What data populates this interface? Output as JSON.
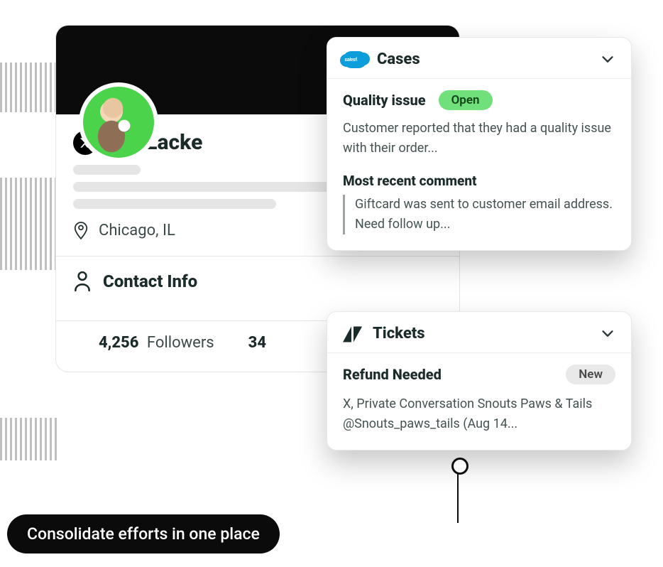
{
  "profile": {
    "name": "Joy Lacke",
    "location": "Chicago, IL",
    "contact_section": "Contact Info",
    "followers_count": "4,256",
    "followers_label": "Followers",
    "stat2_partial": "34"
  },
  "cases": {
    "header": "Cases",
    "salesforce_label": "salesforce",
    "item": {
      "title": "Quality issue",
      "status": "Open",
      "description": "Customer reported that they had a quality issue with their order...",
      "comment_label": "Most recent comment",
      "comment": "Giftcard was sent to customer email address. Need follow up..."
    }
  },
  "tickets": {
    "header": "Tickets",
    "item": {
      "title": "Refund Needed",
      "status": "New",
      "description": "X, Private Conversation Snouts Paws & Tails @Snouts_paws_tails (Aug 14..."
    }
  },
  "caption": "Consolidate efforts in one place"
}
